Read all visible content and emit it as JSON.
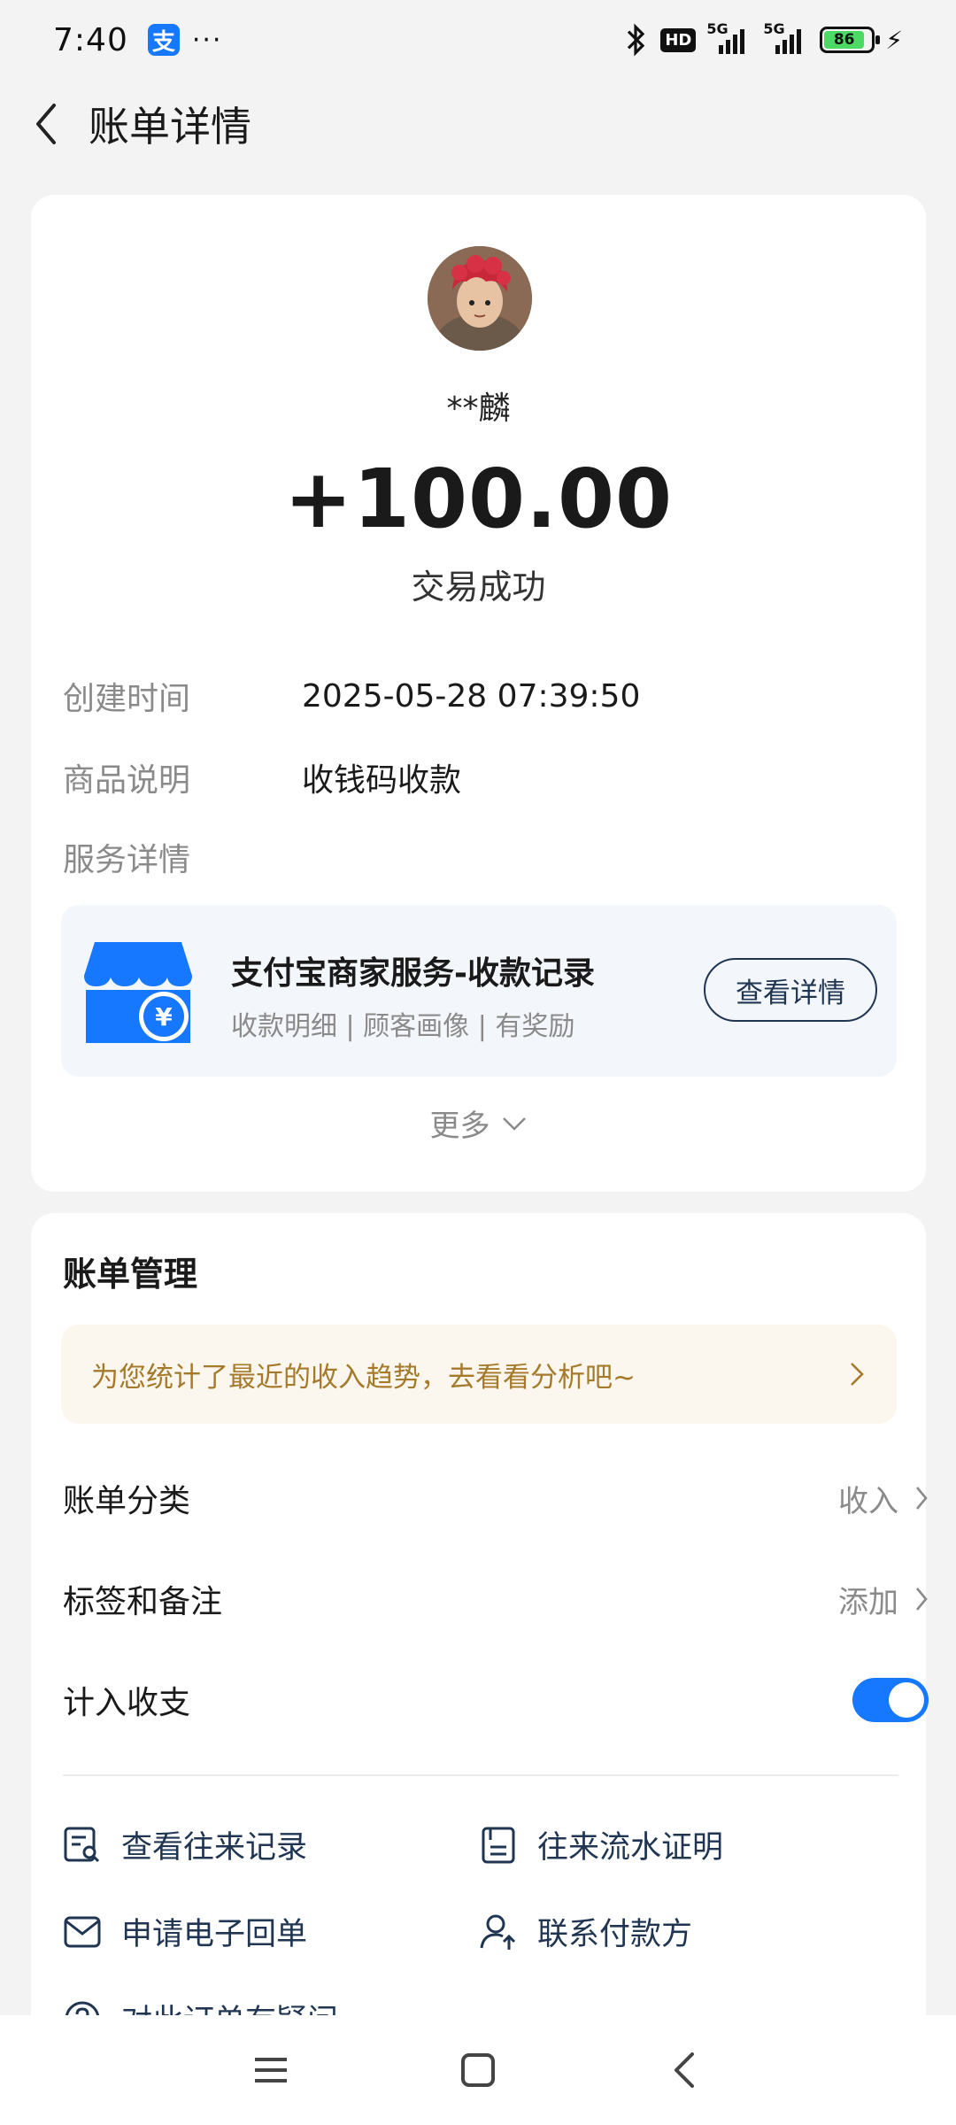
{
  "status_bar": {
    "time": "7:40",
    "alipay_badge": "支",
    "dots": "···",
    "hd": "HD",
    "sig1": "5G",
    "sig2": "5G",
    "battery": "86"
  },
  "header": {
    "title": "账单详情"
  },
  "detail": {
    "payer": "**麟",
    "amount": "+100.00",
    "status": "交易成功",
    "fields": [
      {
        "label": "创建时间",
        "value": "2025-05-28 07:39:50"
      },
      {
        "label": "商品说明",
        "value": "收钱码收款"
      },
      {
        "label": "服务详情",
        "value": ""
      }
    ],
    "service": {
      "title": "支付宝商家服务-收款记录",
      "subtitle": "收款明细 | 顾客画像 | 有奖励",
      "button": "查看详情"
    },
    "more": "更多"
  },
  "manage": {
    "title": "账单管理",
    "promo": "为您统计了最近的收入趋势，去看看分析吧~",
    "rows": [
      {
        "label": "账单分类",
        "value": "收入"
      },
      {
        "label": "标签和备注",
        "value": "添加"
      },
      {
        "label": "计入收支",
        "toggle": true
      }
    ],
    "actions": [
      {
        "label": "查看往来记录",
        "icon": "search-doc-icon"
      },
      {
        "label": "往来流水证明",
        "icon": "doc-icon"
      },
      {
        "label": "申请电子回单",
        "icon": "mail-icon"
      },
      {
        "label": "联系付款方",
        "icon": "person-upload-icon"
      },
      {
        "label": "对此订单有疑问",
        "icon": "help-icon"
      }
    ]
  },
  "colors": {
    "accent": "#1677ff",
    "promo_text": "#a57a2b",
    "action_text": "#1f3552"
  }
}
